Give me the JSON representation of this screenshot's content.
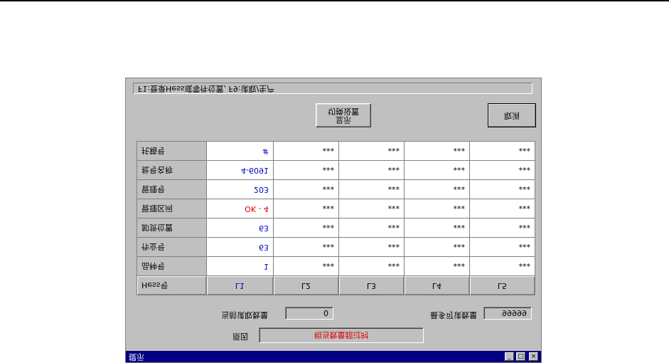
{
  "window": {
    "title": "提示",
    "status_text": "F1:登录Hess或零件位置, F9:读取/生产"
  },
  "buttons": {
    "cancel": "取消",
    "set_display": "显示\n切换设置"
  },
  "grid": {
    "rows": [
      {
        "label": "托箱号",
        "first": "#",
        "cells": [
          "***",
          "***",
          "***",
          "***"
        ]
      },
      {
        "label": "批号名称",
        "first": "4-6091",
        "cells": [
          "***",
          "***",
          "***",
          "***"
        ]
      },
      {
        "label": "管理号",
        "first": "203",
        "cells": [
          "***",
          "***",
          "***",
          "***"
        ]
      },
      {
        "label": "管理区间",
        "first": "OK - 4",
        "cells": [
          "***",
          "***",
          "***",
          "***"
        ]
      },
      {
        "label": "卸货位置",
        "first": "63",
        "cells": [
          "***",
          "***",
          "***",
          "***"
        ]
      },
      {
        "label": "作业号",
        "first": "63",
        "cells": [
          "***",
          "***",
          "***",
          "***"
        ]
      },
      {
        "label": "品种号",
        "first": "1",
        "cells": [
          "***",
          "***",
          "***",
          "***"
        ]
      }
    ],
    "header": {
      "label": "Hess号",
      "cols": [
        "L1",
        "L2",
        "L3",
        "L4",
        "L5"
      ]
    }
  },
  "footer": {
    "current_count_label": "当前读取数量",
    "current_count_value": "0",
    "max_count_label": "最多可读数量",
    "max_count_value": "99999",
    "reason_label": "原因",
    "reason_value": "相当数量超过时"
  },
  "colors": {
    "titlebar": "#000080",
    "blue_value": "#0000c0",
    "red_value": "#e00000",
    "face": "#c0c0c0"
  }
}
